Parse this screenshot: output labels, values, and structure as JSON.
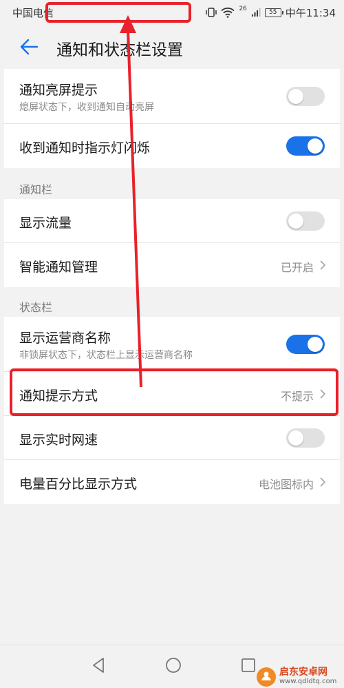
{
  "status_bar": {
    "carrier": "中国电信",
    "network": "26",
    "battery": "55",
    "time": "中午11:34"
  },
  "header": {
    "title": "通知和状态栏设置",
    "back_icon": "back-arrow-icon"
  },
  "group_notify": {
    "rows": [
      {
        "label": "通知亮屏提示",
        "sub": "熄屏状态下，收到通知自动亮屏",
        "toggle": false
      },
      {
        "label": "收到通知时指示灯闪烁",
        "toggle": true
      }
    ]
  },
  "section_notification_bar": {
    "title": "通知栏",
    "rows": [
      {
        "label": "显示流量",
        "toggle": false
      },
      {
        "label": "智能通知管理",
        "value": "已开启"
      }
    ]
  },
  "section_status_bar": {
    "title": "状态栏",
    "rows": [
      {
        "label": "显示运营商名称",
        "sub": "非锁屏状态下，状态栏上显示运营商名称",
        "toggle": true
      },
      {
        "label": "通知提示方式",
        "value": "不提示"
      },
      {
        "label": "显示实时网速",
        "toggle": false
      },
      {
        "label": "电量百分比显示方式",
        "value": "电池图标内"
      }
    ]
  },
  "nav_bar": {
    "back": "nav-back-icon",
    "home": "nav-home-icon",
    "recents": "nav-recents-icon"
  },
  "watermark": {
    "name": "启东安卓网",
    "url": "www.qdldtq.com"
  },
  "colors": {
    "accent": "#1a72e8",
    "annotation": "#e8212a",
    "background": "#f2f2f2"
  }
}
